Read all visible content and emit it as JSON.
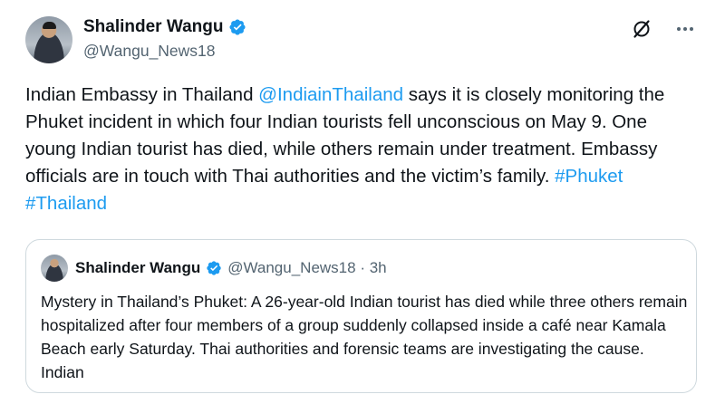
{
  "author": {
    "display_name": "Shalinder Wangu",
    "handle": "@Wangu_News18",
    "verified": true
  },
  "tweet": {
    "text_before_mention": "Indian Embassy in Thailand ",
    "mention": "@IndiainThailand",
    "text_after_mention": " says it is closely monitoring the Phuket incident in which four Indian tourists fell unconscious on May 9. One young Indian tourist has died, while others remain under treatment. Embassy officials are in touch with Thai authorities and the victim’s family. ",
    "hashtag_1": "#Phuket",
    "hashtag_2": "#Thailand"
  },
  "quoted_tweet": {
    "display_name": "Shalinder Wangu",
    "handle": "@Wangu_News18",
    "separator": " · ",
    "time": "3h",
    "text": "Mystery in Thailand’s Phuket: A 26-year-old Indian tourist has died while three others remain hospitalized after four members of a group suddenly collapsed inside a café near Kamala Beach early Saturday. Thai authorities and forensic teams are investigating the cause. Indian"
  },
  "icons": {
    "grok": "grok-icon",
    "more": "more-icon",
    "verified": "verified-badge-icon"
  },
  "colors": {
    "link": "#1d9bf0",
    "secondary_text": "#536471",
    "verified": "#1d9bf0",
    "border": "#cfd9de"
  }
}
